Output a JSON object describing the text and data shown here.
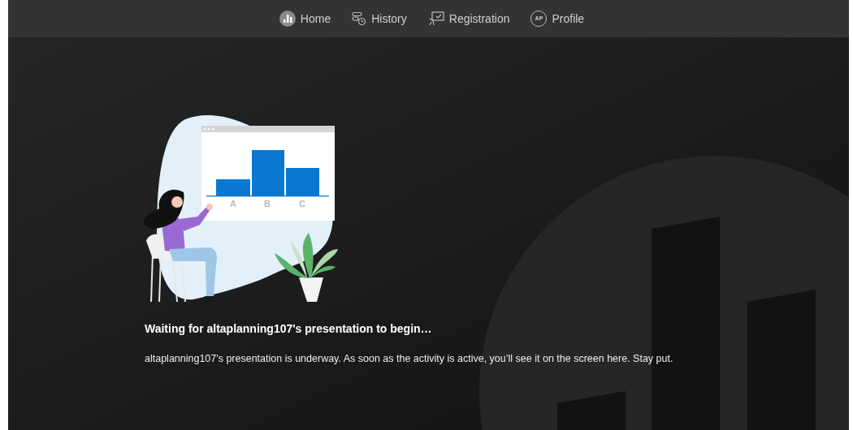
{
  "nav": {
    "items": [
      {
        "kind": "home",
        "label": "Home"
      },
      {
        "kind": "history",
        "label": "History"
      },
      {
        "kind": "registration",
        "label": "Registration"
      },
      {
        "kind": "profile",
        "label": "Profile",
        "initials": "AP"
      }
    ]
  },
  "illustration": {
    "chart_labels": [
      "A",
      "B",
      "C"
    ]
  },
  "message": {
    "title": "Waiting for altaplanning107's presentation to begin…",
    "body": "altaplanning107's presentation is underway. As soon as the activity is active, you’ll see it on the screen here. Stay put."
  }
}
